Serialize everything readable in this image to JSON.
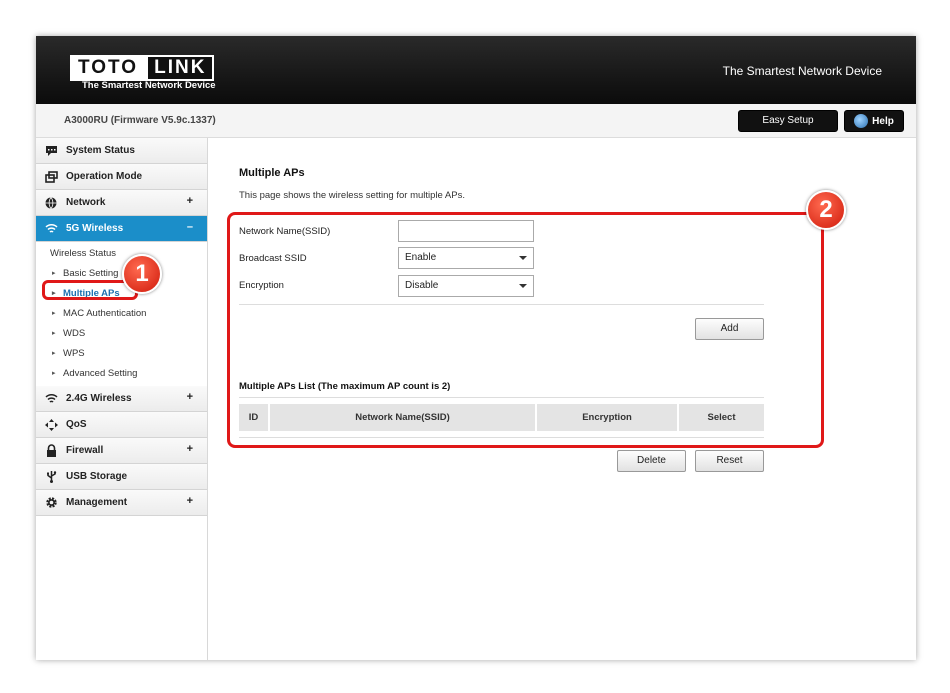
{
  "header": {
    "logo_part1": "TOTO",
    "logo_part2": "LINK",
    "logo_tagline": "The Smartest Network Device",
    "slogan": "The Smartest Network Device"
  },
  "subbar": {
    "model": "A3000RU (Firmware V5.9c.1337)",
    "easy_setup": "Easy Setup",
    "help": "Help"
  },
  "sidebar": {
    "items": [
      {
        "label": "System Status",
        "icon": "chat-icon"
      },
      {
        "label": "Operation Mode",
        "icon": "windows-icon"
      },
      {
        "label": "Network",
        "icon": "globe-icon",
        "toggle": "+"
      },
      {
        "label": "5G Wireless",
        "icon": "wifi-icon",
        "toggle": "–"
      },
      {
        "label": "2.4G Wireless",
        "icon": "wifi-icon",
        "toggle": "+"
      },
      {
        "label": "QoS",
        "icon": "qos-icon"
      },
      {
        "label": "Firewall",
        "icon": "lock-icon",
        "toggle": "+"
      },
      {
        "label": "USB Storage",
        "icon": "usb-icon"
      },
      {
        "label": "Management",
        "icon": "gear-icon",
        "toggle": "+"
      }
    ],
    "sub_items": [
      "Wireless Status",
      "Basic Setting",
      "Multiple APs",
      "MAC Authentication",
      "WDS",
      "WPS",
      "Advanced Setting"
    ]
  },
  "main": {
    "title": "Multiple APs",
    "description": "This page shows the wireless setting for multiple APs.",
    "ssid_label": "Network Name(SSID)",
    "ssid_value": "",
    "broadcast_label": "Broadcast SSID",
    "broadcast_value": "Enable",
    "encryption_label": "Encryption",
    "encryption_value": "Disable",
    "add_button": "Add",
    "list_title": "Multiple APs List (The maximum AP count is 2)",
    "table_headers": [
      "ID",
      "Network Name(SSID)",
      "Encryption",
      "Select"
    ],
    "delete_button": "Delete",
    "reset_button": "Reset"
  },
  "annotations": {
    "badge1": "1",
    "badge2": "2",
    "color": "#e01818"
  }
}
